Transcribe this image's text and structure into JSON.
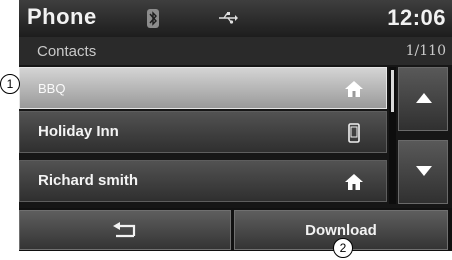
{
  "status_bar": {
    "title": "Phone",
    "time": "12:06",
    "icons": [
      "bluetooth-icon",
      "usb-icon"
    ]
  },
  "subheader": {
    "title": "Contacts",
    "count": "1/110"
  },
  "contacts": [
    {
      "name": "BBQ",
      "icon": "home-icon",
      "selected": true
    },
    {
      "name": "Holiday Inn",
      "icon": "mobile-phone-icon",
      "selected": false
    },
    {
      "name": "Richard smith",
      "icon": "home-icon",
      "selected": false
    }
  ],
  "scroll": {
    "up_icon": "arrow-up-icon",
    "down_icon": "arrow-down-icon"
  },
  "bottom_bar": {
    "back_icon": "back-arrow-icon",
    "download_label": "Download"
  },
  "callouts": {
    "one": "1",
    "two": "2"
  },
  "colors": {
    "panel_background": "#161616",
    "selected_row": "#c0c0c0",
    "text": "#f4f4f4"
  }
}
